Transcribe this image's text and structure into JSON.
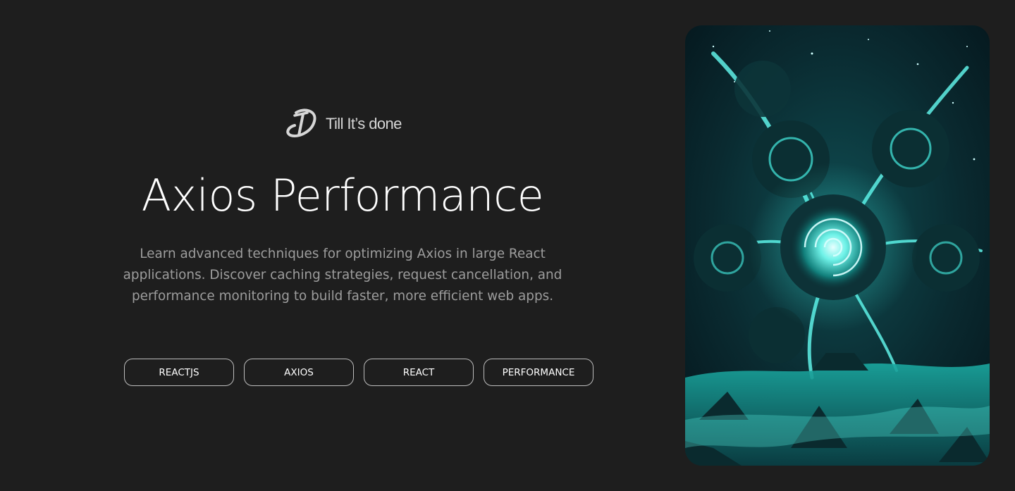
{
  "brand": {
    "name": "Till It’s done",
    "logo_icon": "td-monogram-logo"
  },
  "hero": {
    "title": "Axios Performance",
    "description": "Learn advanced techniques for optimizing Axios in large React applications. Discover caching strategies, request cancellation, and performance monitoring to build faster, more efficient web apps."
  },
  "tags": [
    {
      "label": "REACTJS"
    },
    {
      "label": "AXIOS"
    },
    {
      "label": "REACT"
    },
    {
      "label": "PERFORMANCE"
    }
  ],
  "cover_image": {
    "subject": "teal cosmic swirl landscape",
    "accent_color": "#2de0d4"
  },
  "colors": {
    "background": "#1e1e1e",
    "title": "#ffffff",
    "body_text": "#9d9d9d",
    "tag_border": "#bdbdbd"
  }
}
